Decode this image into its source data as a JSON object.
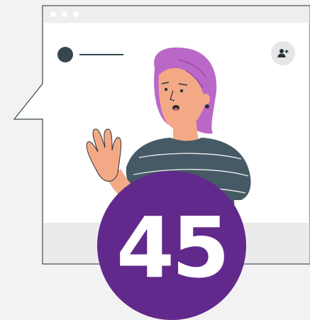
{
  "header": {
    "add_user_icon": "add-user-icon"
  },
  "badge": {
    "number": "45"
  },
  "colors": {
    "background": "#f2f2f2",
    "window": "#ffffff",
    "window_border": "#37474f",
    "badge": "#62298c",
    "hair": "#ba68c8",
    "shirt": "#455a64",
    "skin": "#f4a986"
  }
}
